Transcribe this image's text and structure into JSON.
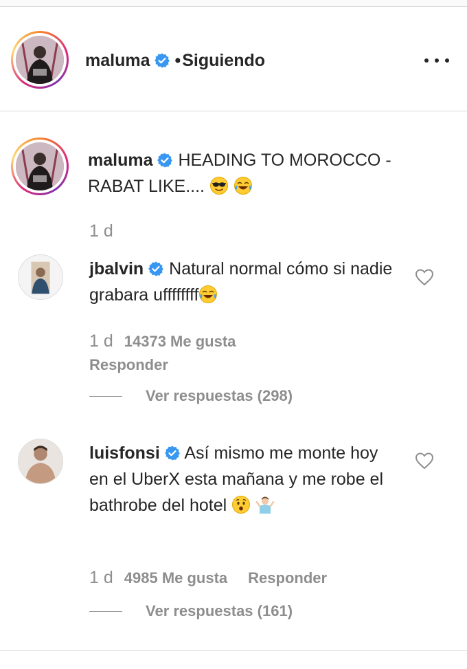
{
  "header": {
    "username": "maluma",
    "separator": "•",
    "follow_status": "Siguiendo",
    "more_icon": "more-options-icon"
  },
  "caption": {
    "username": "maluma",
    "text": "HEADING TO MOROCCO - RABAT LIKE....",
    "emojis": [
      "sunglasses-emoji",
      "tears-of-joy-emoji"
    ],
    "time": "1 d"
  },
  "comments": [
    {
      "username": "jbalvin",
      "text": "Natural normal cómo si nadie grabara uffffffff",
      "emoji": "tears-of-joy-emoji",
      "time": "1 d",
      "likes": "14373 Me gusta",
      "reply_label": "Responder",
      "view_replies": "Ver respuestas (298)"
    },
    {
      "username": "luisfonsi",
      "text": "Así mismo me monte hoy en el UberX esta mañana y me robe el bathrobe del hotel",
      "emojis": [
        "hushed-face-emoji",
        "person-shrugging-emoji"
      ],
      "time": "1 d",
      "likes": "4985 Me gusta",
      "reply_label": "Responder",
      "view_replies": "Ver respuestas (161)"
    }
  ],
  "colors": {
    "text": "#262626",
    "secondary": "#8e8e8e",
    "verified": "#3897f0",
    "divider": "#dbdbdb"
  }
}
